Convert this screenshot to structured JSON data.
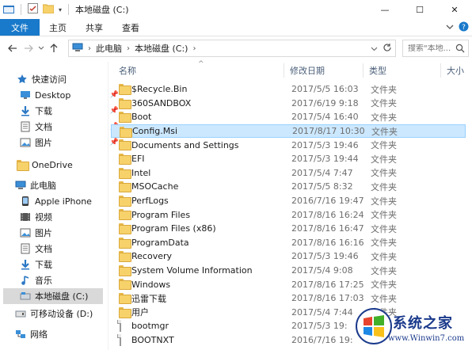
{
  "window": {
    "title": "本地磁盘 (C:)",
    "controls": {
      "minimize": "—",
      "maximize": "☐",
      "close": "✕"
    }
  },
  "ribbon": {
    "tabs": [
      "文件",
      "主页",
      "共享",
      "查看"
    ],
    "expand_icon": "chevron-down-icon",
    "help_icon": "help-icon"
  },
  "address": {
    "crumbs": [
      "此电脑",
      "本地磁盘 (C:)"
    ],
    "search_placeholder": "搜索\"本地..."
  },
  "columns": {
    "name": "名称",
    "date": "修改日期",
    "type": "类型",
    "size": "大小"
  },
  "nav": {
    "items": [
      {
        "label": "快速访问",
        "icon": "star-icon"
      },
      {
        "label": "Desktop",
        "icon": "desktop-icon",
        "pinned": true
      },
      {
        "label": "下载",
        "icon": "download-icon",
        "pinned": true
      },
      {
        "label": "文档",
        "icon": "document-icon",
        "pinned": true
      },
      {
        "label": "图片",
        "icon": "picture-icon",
        "pinned": true
      },
      {
        "label": "OneDrive",
        "icon": "folder-icon"
      },
      {
        "label": "此电脑",
        "icon": "computer-icon"
      },
      {
        "label": "Apple iPhone",
        "icon": "phone-icon"
      },
      {
        "label": "视频",
        "icon": "video-icon"
      },
      {
        "label": "图片",
        "icon": "picture-icon"
      },
      {
        "label": "文档",
        "icon": "document-icon"
      },
      {
        "label": "下载",
        "icon": "download-icon"
      },
      {
        "label": "音乐",
        "icon": "music-icon"
      },
      {
        "label": "本地磁盘 (C:)",
        "icon": "drive-icon",
        "selected": true
      },
      {
        "label": "可移动设备 (D:)",
        "icon": "usb-drive-icon"
      },
      {
        "label": "网络",
        "icon": "network-icon"
      }
    ]
  },
  "files": [
    {
      "name": "$Recycle.Bin",
      "date": "2017/5/5 16:03",
      "type": "文件夹",
      "kind": "folder"
    },
    {
      "name": "360SANDBOX",
      "date": "2017/6/19 9:18",
      "type": "文件夹",
      "kind": "folder"
    },
    {
      "name": "Boot",
      "date": "2017/5/4 16:40",
      "type": "文件夹",
      "kind": "folder"
    },
    {
      "name": "Config.Msi",
      "date": "2017/8/17 10:30",
      "type": "文件夹",
      "kind": "folder",
      "selected": true
    },
    {
      "name": "Documents and Settings",
      "date": "2017/5/3 19:46",
      "type": "文件夹",
      "kind": "folder"
    },
    {
      "name": "EFI",
      "date": "2017/5/3 19:44",
      "type": "文件夹",
      "kind": "folder"
    },
    {
      "name": "Intel",
      "date": "2017/5/4 7:47",
      "type": "文件夹",
      "kind": "folder"
    },
    {
      "name": "MSOCache",
      "date": "2017/5/5 8:32",
      "type": "文件夹",
      "kind": "folder"
    },
    {
      "name": "PerfLogs",
      "date": "2016/7/16 19:47",
      "type": "文件夹",
      "kind": "folder"
    },
    {
      "name": "Program Files",
      "date": "2017/8/16 16:24",
      "type": "文件夹",
      "kind": "folder"
    },
    {
      "name": "Program Files (x86)",
      "date": "2017/8/16 16:47",
      "type": "文件夹",
      "kind": "folder"
    },
    {
      "name": "ProgramData",
      "date": "2017/8/16 16:16",
      "type": "文件夹",
      "kind": "folder"
    },
    {
      "name": "Recovery",
      "date": "2017/5/3 19:46",
      "type": "文件夹",
      "kind": "folder"
    },
    {
      "name": "System Volume Information",
      "date": "2017/5/4 9:08",
      "type": "文件夹",
      "kind": "folder"
    },
    {
      "name": "Windows",
      "date": "2017/8/16 17:25",
      "type": "文件夹",
      "kind": "folder"
    },
    {
      "name": "迅雷下载",
      "date": "2017/8/16 17:03",
      "type": "文件夹",
      "kind": "folder"
    },
    {
      "name": "用户",
      "date": "2017/5/4 7:44",
      "type": "文件夹",
      "kind": "folder"
    },
    {
      "name": "bootmgr",
      "date": "2017/5/3 19:",
      "type": "",
      "kind": "file"
    },
    {
      "name": "BOOTNXT",
      "date": "2016/7/16 19:",
      "type": "",
      "kind": "file"
    }
  ],
  "watermark": {
    "title": "系统之家",
    "url": "www.Winwin7.com"
  }
}
